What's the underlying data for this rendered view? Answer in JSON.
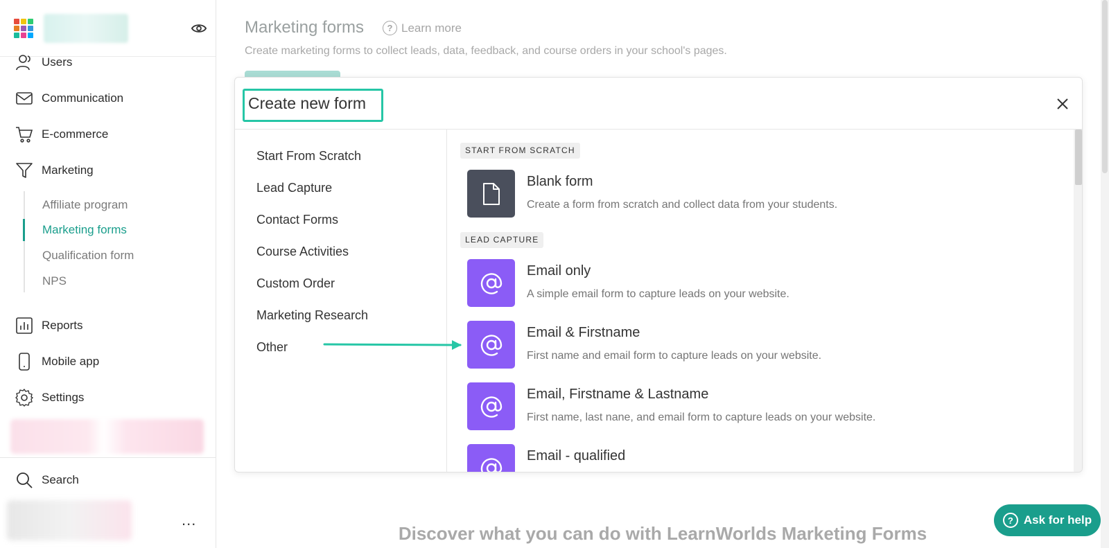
{
  "sidebar": {
    "nav": [
      {
        "label": "Users",
        "icon": "users-icon"
      },
      {
        "label": "Communication",
        "icon": "mail-icon"
      },
      {
        "label": "E-commerce",
        "icon": "cart-icon"
      },
      {
        "label": "Marketing",
        "icon": "funnel-icon"
      }
    ],
    "marketing_sub": [
      {
        "label": "Affiliate program",
        "active": false
      },
      {
        "label": "Marketing forms",
        "active": true
      },
      {
        "label": "Qualification form",
        "active": false
      },
      {
        "label": "NPS",
        "active": false
      }
    ],
    "nav_bottom": [
      {
        "label": "Reports",
        "icon": "chart-icon"
      },
      {
        "label": "Mobile app",
        "icon": "phone-icon"
      },
      {
        "label": "Settings",
        "icon": "gear-icon"
      }
    ],
    "search_label": "Search",
    "more_label": "..."
  },
  "page": {
    "title": "Marketing forms",
    "learn_more": "Learn more",
    "subtitle": "Create marketing forms to collect leads, data, feedback, and course orders in your school's pages.",
    "discover": "Discover what you can do with LearnWorlds Marketing Forms"
  },
  "modal": {
    "title": "Create new form",
    "categories": [
      "Start From Scratch",
      "Lead Capture",
      "Contact Forms",
      "Course Activities",
      "Custom Order",
      "Marketing Research",
      "Other"
    ],
    "sections": [
      {
        "tag": "START FROM SCRATCH"
      },
      {
        "tag": "LEAD CAPTURE"
      }
    ],
    "templates": [
      {
        "title": "Blank form",
        "desc": "Create a form from scratch and collect data from your students."
      },
      {
        "title": "Email only",
        "desc": "A simple email form to capture leads on your website."
      },
      {
        "title": "Email & Firstname",
        "desc": "First name and email form to capture leads on your website."
      },
      {
        "title": "Email, Firstname & Lastname",
        "desc": "First name, last nane, and email form to capture leads on your website."
      },
      {
        "title": "Email - qualified",
        "desc": ""
      }
    ]
  },
  "help": {
    "label": "Ask for help"
  },
  "colors": {
    "accent": "#1a9e8c",
    "highlight": "#26c6a6",
    "tile_purple": "#8b5cf6",
    "tile_dark": "#4a4f5c"
  }
}
